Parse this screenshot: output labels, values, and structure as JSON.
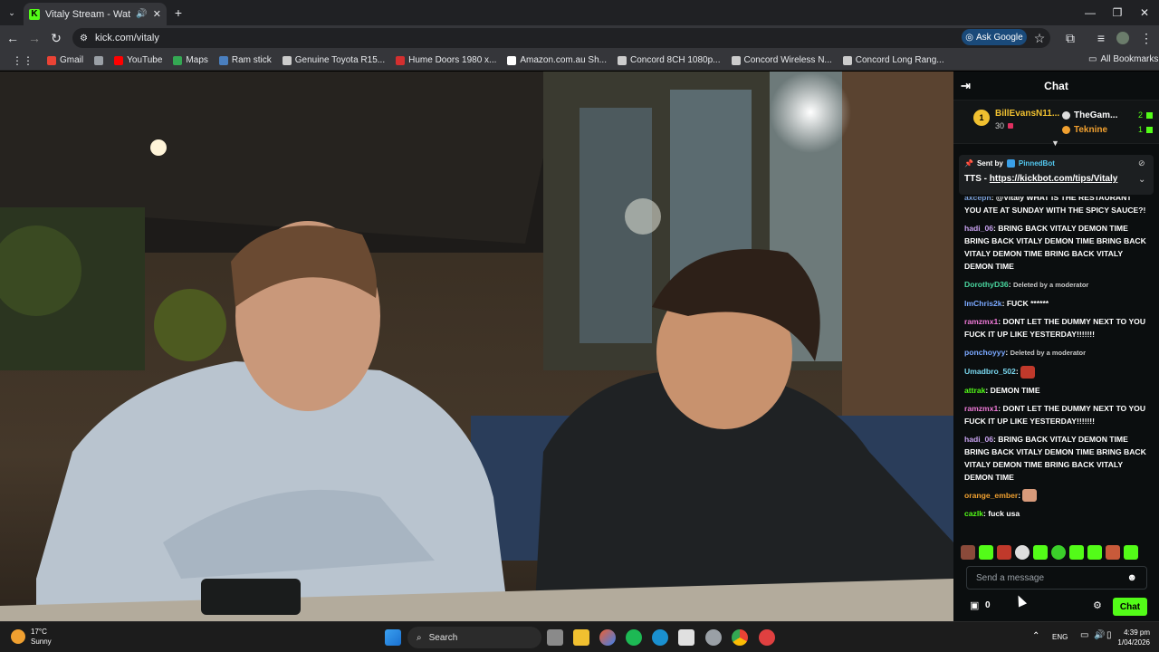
{
  "browser": {
    "tab_title": "Vitaly Stream - Watch Live o",
    "favicon_letter": "K",
    "url": "kick.com/vitaly",
    "ask_google": "Ask Google",
    "bookmarks": [
      {
        "label": "Gmail",
        "color": "#ea4335"
      },
      {
        "label": "",
        "color": "#9aa0a6"
      },
      {
        "label": "YouTube",
        "color": "#ff0000"
      },
      {
        "label": "Maps",
        "color": "#34a853"
      },
      {
        "label": "Ram stick",
        "color": "#4a7fbf"
      },
      {
        "label": "Genuine Toyota R15...",
        "color": "#cccccc"
      },
      {
        "label": "Hume Doors 1980 x...",
        "color": "#d32f2f"
      },
      {
        "label": "Amazon.com.au Sh...",
        "color": "#ffffff"
      },
      {
        "label": "Concord 8CH 1080p...",
        "color": "#cccccc"
      },
      {
        "label": "Concord Wireless N...",
        "color": "#cccccc"
      },
      {
        "label": "Concord Long Rang...",
        "color": "#cccccc"
      }
    ],
    "all_bookmarks": "All Bookmarks"
  },
  "chat": {
    "header": "Chat",
    "leaderboard": {
      "rank1_badge": "1",
      "rank1_name": "BillEvansN11...",
      "rank1_count": "30",
      "side": [
        {
          "name": "TheGam...",
          "count": "2",
          "color": "#ffffff"
        },
        {
          "name": "Teknine",
          "count": "1",
          "color": "#f0a030"
        }
      ]
    },
    "pinned": {
      "sent_by": "Sent by",
      "bot": "PinnedBot",
      "text_prefix": "TTS - ",
      "link": "https://kickbot.com/tips/Vitaly"
    },
    "messages": [
      {
        "user": "axceph",
        "color": "#7a9fd8",
        "text": "@Vitaly WHAT IS THE RESTAURANT YOU ATE AT SUNDAY WITH THE SPICY SAUCE?!"
      },
      {
        "user": "hadi_06",
        "color": "#c8a2f0",
        "text": "BRING BACK VITALY DEMON TIME BRING BACK VITALY DEMON TIME BRING BACK VITALY DEMON TIME BRING BACK VITALY DEMON TIME"
      },
      {
        "user": "DorothyD36",
        "color": "#4ad8a0",
        "deleted": "Deleted by a moderator"
      },
      {
        "user": "ImChris2k",
        "color": "#7aa8ff",
        "text": "FUCK ******"
      },
      {
        "user": "ramzmx1",
        "color": "#f07ad8",
        "text": "DONT LET THE DUMMY NEXT TO YOU FUCK IT UP LIKE YESTERDAY!!!!!!!"
      },
      {
        "user": "ponchoyyy",
        "color": "#7aa8ff",
        "deleted": "Deleted by a moderator"
      },
      {
        "user": "Umadbro_502",
        "color": "#7ad8f0",
        "emote": true
      },
      {
        "user": "attrak",
        "color": "#53fc18",
        "text": "DEMON TIME"
      },
      {
        "user": "ramzmx1",
        "color": "#f07ad8",
        "text": "DONT LET THE DUMMY NEXT TO YOU FUCK IT UP LIKE YESTERDAY!!!!!!!"
      },
      {
        "user": "hadi_06",
        "color": "#c8a2f0",
        "text": "BRING BACK VITALY DEMON TIME BRING BACK VITALY DEMON TIME BRING BACK VITALY DEMON TIME BRING BACK VITALY DEMON TIME"
      },
      {
        "user": "orange_ember",
        "color": "#f0a030",
        "emote": true
      },
      {
        "user": "cazlk",
        "color": "#53fc18",
        "text": "fuck usa"
      }
    ],
    "input_placeholder": "Send a message",
    "viewer_count": "0",
    "send_label": "Chat"
  },
  "taskbar": {
    "temp": "17°C",
    "weather": "Sunny",
    "search": "Search",
    "lang": "ENG",
    "time": "4:39 pm",
    "date": "1/04/2026"
  }
}
